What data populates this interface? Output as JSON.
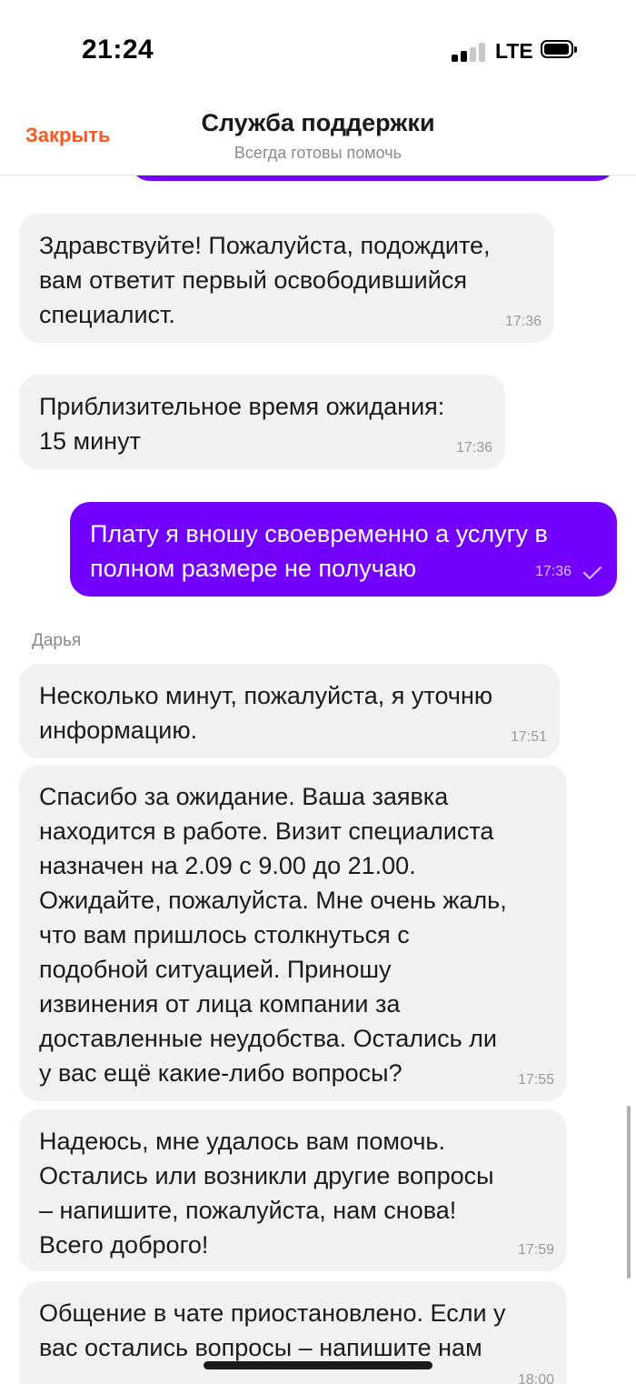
{
  "status_bar": {
    "time": "21:24",
    "network": "LTE"
  },
  "header": {
    "close_label": "Закрыть",
    "title": "Служба поддержки",
    "subtitle": "Всегда готовы помочь"
  },
  "colors": {
    "accent": "#ff5722",
    "outgoing_bubble": "#7300ff",
    "incoming_bubble": "#f2f2f2"
  },
  "messages": [
    {
      "text": "Здравствуйте! Пожалуйста, подождите,\nвам ответит первый освободившийся\nспециалист.",
      "time": "17:36"
    },
    {
      "text": "Приблизительное время ожидания:\n15 минут",
      "time": "17:36"
    },
    {
      "text": "Плату я вношу своевременно а услугу в\nполном размере не получаю",
      "time": "17:36"
    },
    {
      "sender": "Дарья",
      "text": "Несколько минут, пожалуйста, я уточню\nинформацию.",
      "time": "17:51"
    },
    {
      "text": "Спасибо за ожидание. Ваша заявка\nнаходится в работе. Визит специалиста\nназначен на 2.09 с 9.00 до 21.00.\nОжидайте, пожалуйста. Мне очень жаль,\nчто вам пришлось столкнуться с\nподобной ситуацией. Приношу\nизвинения от лица компании за\nдоставленные неудобства. Остались ли\nу вас ещё какие-либо вопросы?",
      "time": "17:55"
    },
    {
      "text": "Надеюсь, мне удалось вам помочь.\nОстались или возникли другие вопросы\n– напишите, пожалуйста, нам снова!\nВсего доброго!",
      "time": "17:59"
    },
    {
      "text": "Общение в чате приостановлено. Если у\nвас остались вопросы – напишите нам",
      "time": "18:00"
    }
  ]
}
